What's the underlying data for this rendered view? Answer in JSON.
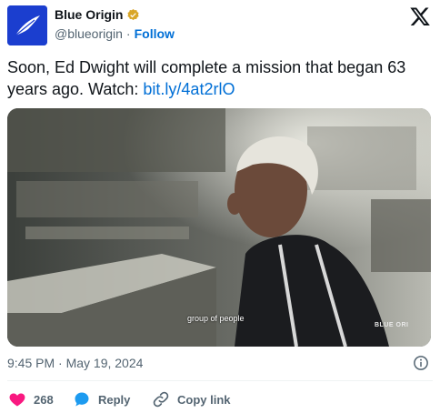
{
  "account": {
    "display_name": "Blue Origin",
    "handle": "@blueorigin",
    "separator": "·",
    "follow_label": "Follow",
    "verified_badge_color": "#d9a627",
    "avatar_color": "#1b3ecf"
  },
  "tweet": {
    "text": "Soon, Ed Dwight will complete a mission that began 63 years ago. Watch: ",
    "link_text": "bit.ly/4at2rlO",
    "timestamp": "9:45 PM · May 19, 2024"
  },
  "media": {
    "subtitle": "group of people",
    "watermark": "BLUE ORI"
  },
  "actions": {
    "like_count": "268",
    "reply_label": "Reply",
    "copy_link_label": "Copy link"
  },
  "colors": {
    "link": "#006fd6",
    "like": "#f91880",
    "reply": "#1d9bf0",
    "muted": "#536471"
  },
  "icons": [
    "feather-logo-icon",
    "verified-badge-icon",
    "x-logo-icon",
    "info-icon",
    "heart-icon",
    "reply-bubble-icon",
    "link-icon"
  ]
}
